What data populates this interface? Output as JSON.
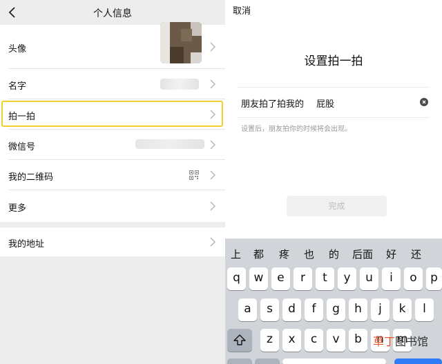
{
  "left": {
    "nav_title": "个人信息",
    "rows": {
      "avatar": "头像",
      "name": "名字",
      "pat": "拍一拍",
      "wxid": "微信号",
      "qr": "我的二维码",
      "more": "更多",
      "address": "我的地址"
    }
  },
  "right": {
    "cancel": "取消",
    "title": "设置拍一拍",
    "prefix": "朋友拍了拍我的",
    "input_value": "屁股",
    "hint": "设置后，朋友拍你的时候将会出现。",
    "done": "完成"
  },
  "keyboard": {
    "candidates": [
      "上",
      "都",
      "疼",
      "也",
      "的",
      "后面",
      "好",
      "还"
    ],
    "row1": [
      "q",
      "w",
      "e",
      "r",
      "t",
      "y",
      "u",
      "i",
      "o",
      "p"
    ],
    "row2": [
      "a",
      "s",
      "d",
      "f",
      "g",
      "h",
      "j",
      "k",
      "l"
    ],
    "row3": [
      "z",
      "x",
      "c",
      "v",
      "b",
      "n",
      "m"
    ]
  },
  "watermark": {
    "colored": "草丁",
    "plain": "图书馆"
  },
  "colors": {
    "highlight": "#f2cf2c",
    "keyboard_bg": "#d1d4d9",
    "watermark_accent": "#e8562c"
  }
}
